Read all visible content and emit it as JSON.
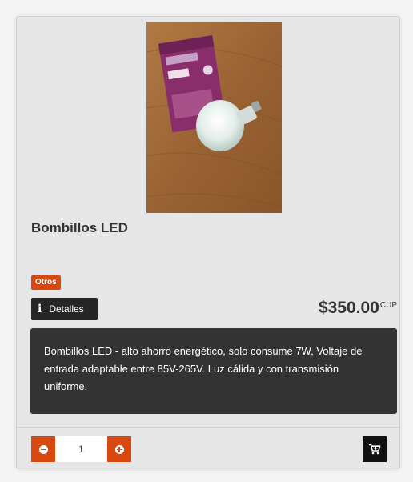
{
  "product": {
    "title": "Bombillos LED",
    "category_badge": "Otros",
    "details_label": "Detalles",
    "price": "$350.00",
    "currency": "CUP",
    "description": "Bombillos LED - alto ahorro energético, solo consume 7W, Voltaje de entrada adaptable entre 85V-265V. Luz cálida y con transmisión uniforme."
  },
  "quantity": {
    "value": "1"
  },
  "colors": {
    "accent": "#d8480f",
    "dark": "#262626",
    "card_bg": "#e6e6e6"
  },
  "icons": {
    "details": "info-icon",
    "minus": "minus-icon",
    "plus": "plus-icon",
    "cart": "cart-icon"
  }
}
